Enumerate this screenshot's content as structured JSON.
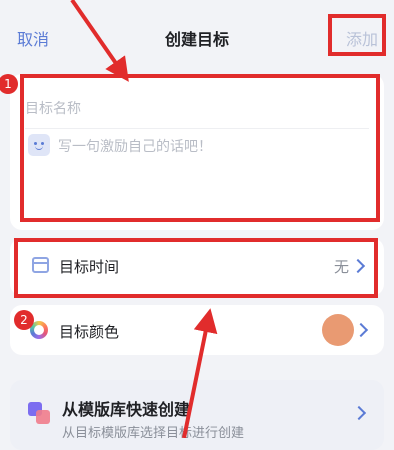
{
  "header": {
    "cancel_label": "取消",
    "title": "创建目标",
    "add_label": "添加"
  },
  "name_card": {
    "name_placeholder": "目标名称",
    "motto_placeholder": "写一句激励自己的话吧！",
    "motto_icon": "smile-face-icon"
  },
  "time_row": {
    "icon": "calendar-icon",
    "label": "目标时间",
    "value": "无",
    "chevron": "chevron-right-icon"
  },
  "color_row": {
    "icon": "color-ring-icon",
    "label": "目标颜色",
    "swatch_color": "#e99a72",
    "chevron": "chevron-right-icon"
  },
  "template_card": {
    "icon": "template-icon",
    "title": "从模版库快速创建",
    "subtitle": "从目标模版库选择目标进行创建",
    "chevron": "chevron-right-icon"
  },
  "annotations": {
    "badge_1": "1",
    "badge_2": "2",
    "color": "#e12c2c"
  },
  "colors": {
    "accent": "#5b7bd5",
    "add_disabled": "#b9c2d8",
    "background": "#f2f3f7"
  }
}
